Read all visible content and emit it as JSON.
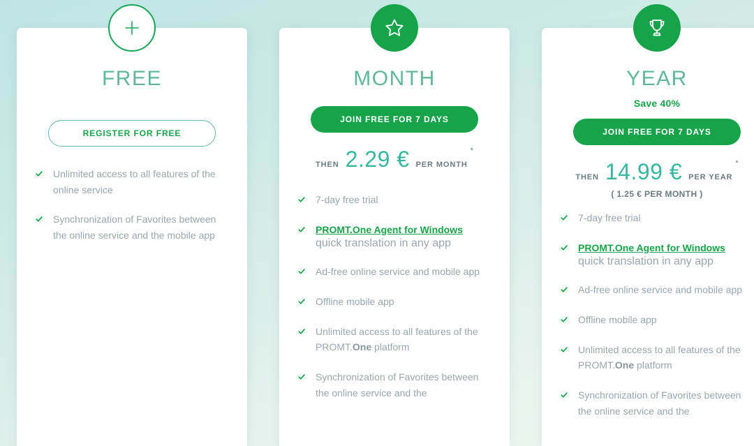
{
  "theme": {
    "accent_green": "#16a34a",
    "title_green": "#5fb89a",
    "price_teal": "#35b89b",
    "muted_text": "#9aa6ac",
    "background": "#cfeae5"
  },
  "plans": [
    {
      "id": "free",
      "icon": "plus-icon",
      "title": "FREE",
      "save_label": "",
      "button": {
        "label": "REGISTER FOR FREE",
        "style": "outline"
      },
      "price": {
        "then": "",
        "amount": "",
        "period": "",
        "star": "",
        "sub": ""
      },
      "features": [
        {
          "text": "Unlimited access to all features of the online service"
        },
        {
          "text": "Synchronization of Favorites between the online service and the mobile app"
        }
      ]
    },
    {
      "id": "month",
      "icon": "star-icon",
      "title": "MONTH",
      "save_label": "",
      "button": {
        "label": "JOIN FREE FOR 7 DAYS",
        "style": "solid"
      },
      "price": {
        "then": "THEN",
        "amount": "2.29 €",
        "period": "PER MONTH",
        "star": "*",
        "sub": ""
      },
      "features": [
        {
          "text": "7-day free trial"
        },
        {
          "link": "PROMT.One Agent for Windows",
          "note": "quick translation in any app"
        },
        {
          "text": "Ad-free online service and mobile app"
        },
        {
          "text": "Offline mobile app"
        },
        {
          "text_pre": "Unlimited access to all features of the PROMT.",
          "text_bold": "One",
          "text_post": " platform"
        },
        {
          "text": "Synchronization of Favorites between the online service and the"
        }
      ]
    },
    {
      "id": "year",
      "icon": "trophy-icon",
      "title": "YEAR",
      "save_label": "Save 40%",
      "button": {
        "label": "JOIN FREE FOR 7 DAYS",
        "style": "solid"
      },
      "price": {
        "then": "THEN",
        "amount": "14.99 €",
        "period": "PER YEAR",
        "star": "*",
        "sub": "( 1.25 € PER MONTH )"
      },
      "features": [
        {
          "text": "7-day free trial"
        },
        {
          "link": "PROMT.One Agent for Windows",
          "note": "quick translation in any app"
        },
        {
          "text": "Ad-free online service and mobile app"
        },
        {
          "text": "Offline mobile app"
        },
        {
          "text_pre": "Unlimited access to all features of the PROMT.",
          "text_bold": "One",
          "text_post": " platform"
        },
        {
          "text": "Synchronization of Favorites between the online service and the"
        }
      ]
    }
  ]
}
